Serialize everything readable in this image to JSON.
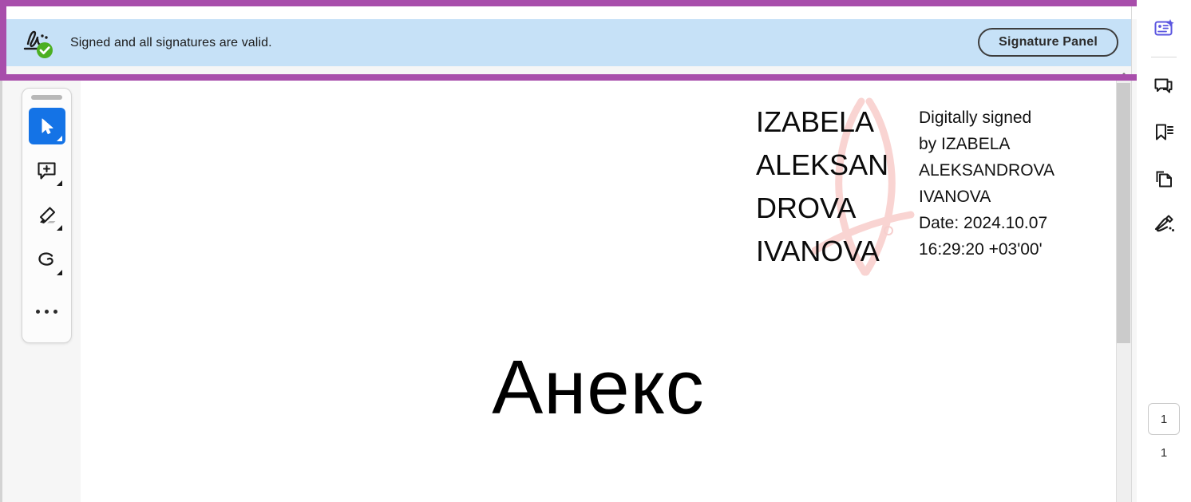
{
  "app": {
    "ai_pill": {
      "name": "ai-assistant-button",
      "label": ""
    }
  },
  "signature_bar": {
    "icon": "signature-valid-icon",
    "message": "Signed and all signatures are valid.",
    "panel_button_label": "Signature Panel",
    "background_color": "#c6e1f7"
  },
  "annotation": {
    "name": "purple-highlight-box",
    "color": "#a84eab"
  },
  "toolbar": {
    "items": [
      {
        "name": "select-tool",
        "icon": "cursor-arrow-icon",
        "active": true,
        "has_menu": true
      },
      {
        "name": "add-comment-tool",
        "icon": "comment-plus-icon",
        "active": false,
        "has_menu": true
      },
      {
        "name": "highlight-tool",
        "icon": "highlighter-icon",
        "active": false,
        "has_menu": true
      },
      {
        "name": "freehand-draw-tool",
        "icon": "lasso-draw-icon",
        "active": false,
        "has_menu": true
      },
      {
        "name": "more-tools",
        "icon": "ellipsis-icon",
        "active": false,
        "has_menu": false
      }
    ]
  },
  "document": {
    "title": "Анекс",
    "signature_stamp": {
      "signer_name": "IZABELA\nALEKSAN\nDROVA\nIVANOVA",
      "details": "Digitally signed\nby IZABELA\nALEKSANDROVA\nIVANOVA\nDate: 2024.10.07\n16:29:20 +03'00'",
      "watermark_icon": "adobe-a-watermark",
      "watermark_color": "#f9d4d2"
    }
  },
  "right_rail": {
    "items": [
      {
        "name": "ai-assistant-icon",
        "icon": "ai-sparkle-card-icon",
        "accent_color": "#5b56e0"
      },
      {
        "name": "comments-icon",
        "icon": "speech-bubbles-icon"
      },
      {
        "name": "bookmarks-icon",
        "icon": "bookmark-list-icon"
      },
      {
        "name": "page-thumbnails-icon",
        "icon": "copy-pages-icon"
      },
      {
        "name": "fill-and-sign-icon",
        "icon": "pen-signature-icon"
      }
    ]
  },
  "page_navigation": {
    "current_page": "1",
    "total_pages": "1"
  }
}
